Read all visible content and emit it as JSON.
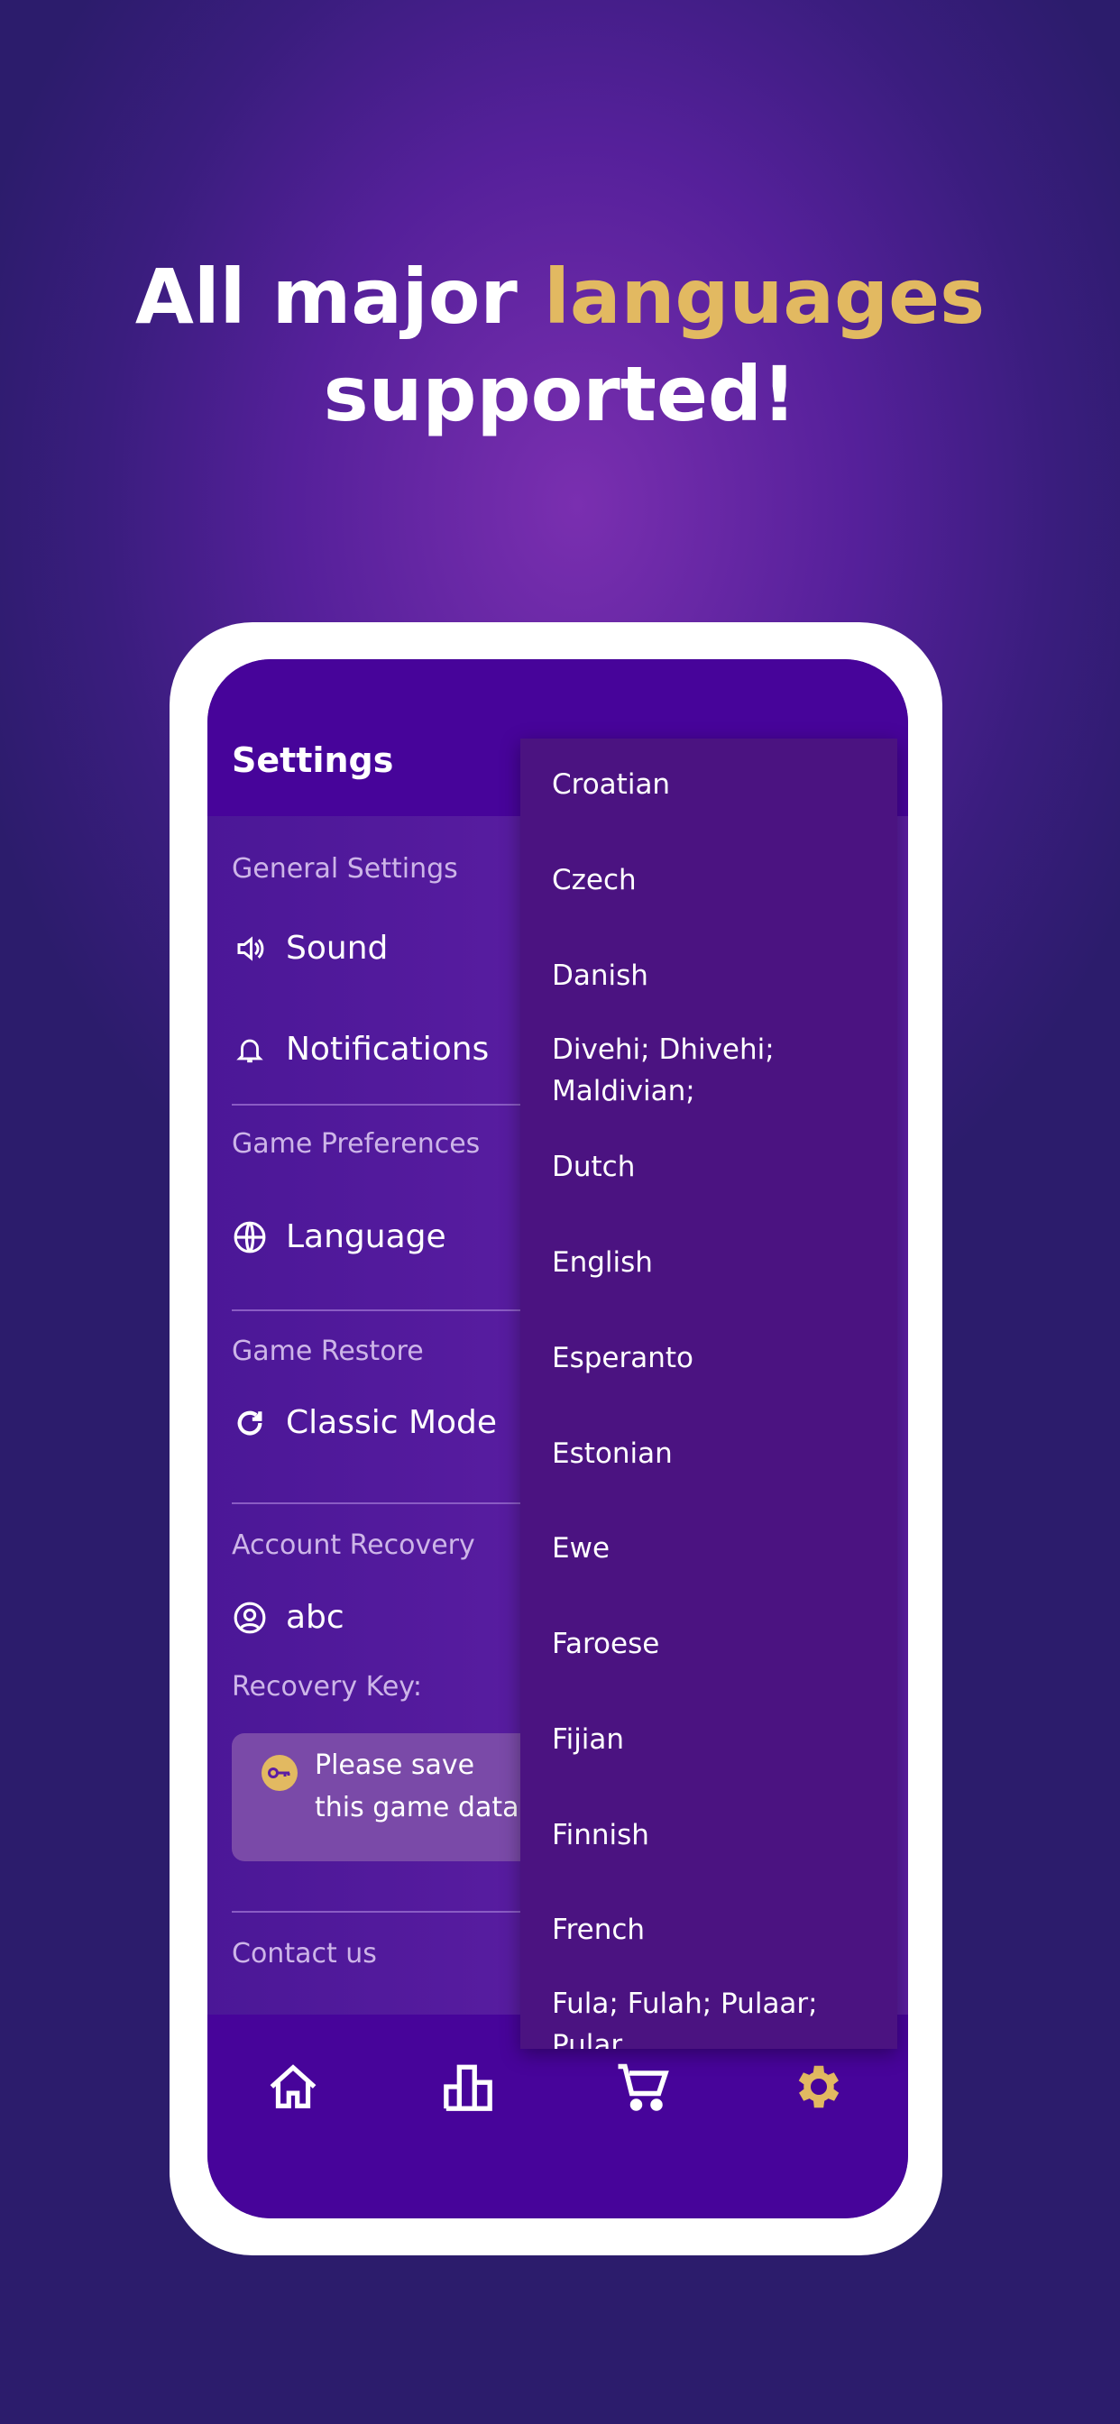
{
  "headline": {
    "part1": "All major ",
    "highlight": "languages",
    "part2": "supported!"
  },
  "colors": {
    "accent": "#e2b961",
    "appbar": "#47049a"
  },
  "settings": {
    "title": "Settings",
    "general_label": "General Settings",
    "sound": "Sound",
    "notifications": "Notifications",
    "prefs_label": "Game Preferences",
    "language": "Language",
    "restore_label": "Game Restore",
    "classic_mode": "Classic Mode",
    "recovery_label": "Account Recovery",
    "username": "abc",
    "recovery_key_label": "Recovery Key:",
    "key_notice": "Please save this game data in t",
    "contact_label": "Contact us"
  },
  "language_options": [
    "Croatian",
    "Czech",
    "Danish",
    "Divehi; Dhivehi; Maldivian;",
    "Dutch",
    "English",
    "Esperanto",
    "Estonian",
    "Ewe",
    "Faroese",
    "Fijian",
    "Finnish",
    "French",
    "Fula; Fulah; Pulaar; Pular"
  ],
  "nav": [
    {
      "icon": "home-icon"
    },
    {
      "icon": "leaderboard-icon"
    },
    {
      "icon": "cart-icon"
    },
    {
      "icon": "gear-icon",
      "active": true
    }
  ]
}
